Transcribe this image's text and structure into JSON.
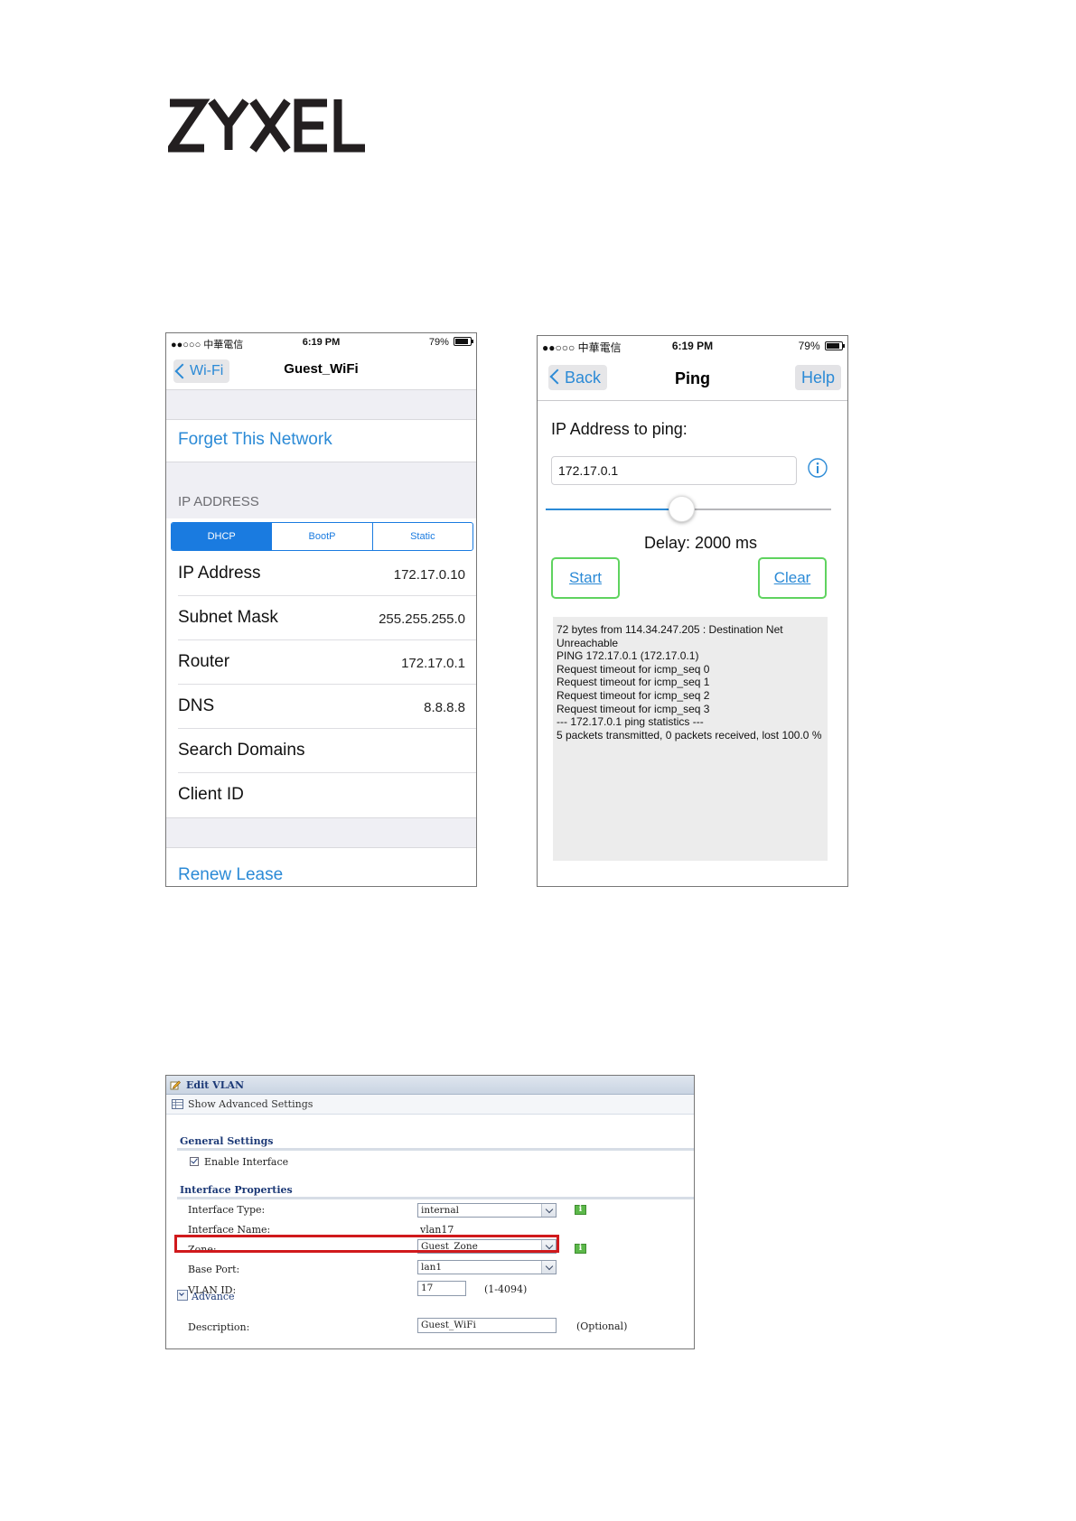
{
  "logo": {
    "text": "ZYXEL"
  },
  "wifi_screen": {
    "status_bar": {
      "carrier": "●●○○○ 中華電信",
      "time": "6:19 PM",
      "battery": "79%"
    },
    "back_label": "Wi-Fi",
    "title": "Guest_WiFi",
    "forget_label": "Forget This Network",
    "section_header": "IP ADDRESS",
    "segments": [
      "DHCP",
      "BootP",
      "Static"
    ],
    "active_segment": "DHCP",
    "rows": [
      {
        "label": "IP Address",
        "value": "172.17.0.10"
      },
      {
        "label": "Subnet Mask",
        "value": "255.255.255.0"
      },
      {
        "label": "Router",
        "value": "172.17.0.1"
      },
      {
        "label": "DNS",
        "value": "8.8.8.8"
      },
      {
        "label": "Search Domains",
        "value": ""
      },
      {
        "label": "Client ID",
        "value": ""
      }
    ],
    "renew_label": "Renew Lease"
  },
  "ping_screen": {
    "status_bar": {
      "carrier": "●●○○○ 中華電信",
      "time": "6:19 PM",
      "battery": "79%"
    },
    "back_label": "Back",
    "title": "Ping",
    "help_label": "Help",
    "ip_label": "IP Address to ping:",
    "ip_value": "172.17.0.1",
    "delay_label": "Delay: 2000 ms",
    "slider_fraction": 0.47,
    "start_label": "Start",
    "clear_label": "Clear",
    "log": [
      "72 bytes from 114.34.247.205 : Destination Net Unreachable",
      "PING 172.17.0.1 (172.17.0.1)",
      "Request timeout for icmp_seq 0",
      "Request timeout for icmp_seq 1",
      "Request timeout for icmp_seq 2",
      "Request timeout for icmp_seq 3",
      "--- 172.17.0.1 ping statistics ---",
      "5 packets transmitted, 0 packets received, lost 100.0 %"
    ]
  },
  "vlan_panel": {
    "title": "Edit VLAN",
    "advanced_toggle": "Show Advanced Settings",
    "general_header": "General Settings",
    "enable_label": "Enable Interface",
    "enable_checked": true,
    "properties_header": "Interface Properties",
    "interface_type_label": "Interface Type:",
    "interface_type_value": "internal",
    "interface_name_label": "Interface Name:",
    "interface_name_value": "vlan17",
    "zone_label": "Zone:",
    "zone_value": "Guest_Zone",
    "base_port_label": "Base Port:",
    "base_port_value": "lan1",
    "vlan_id_label": "VLAN ID:",
    "vlan_id_value": "17",
    "vlan_id_range": "(1-4094)",
    "advance_label": "Advance",
    "description_label": "Description:",
    "description_value": "Guest_WiFi",
    "description_hint": "(Optional)",
    "highlight_color": "#d0191c",
    "info_icon_color": "#5cb84a"
  }
}
